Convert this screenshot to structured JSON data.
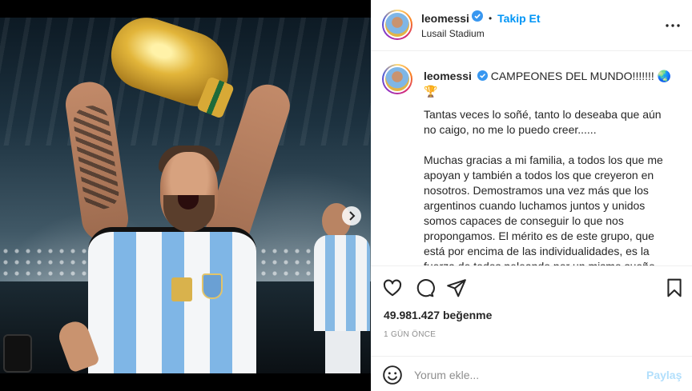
{
  "post": {
    "account": {
      "username": "leomessi",
      "separator": "•",
      "follow_label": "Takip Et",
      "location": "Lusail Stadium"
    },
    "caption": {
      "username": "leomessi",
      "headline": "CAMPEONES DEL MUNDO!!!!!!! ",
      "headline_emoji": "🌏 🏆",
      "paragraphs": [
        "Tantas veces lo soñé, tanto lo deseaba que aún no caigo, no me lo puedo creer......",
        "Muchas gracias a mi familia, a todos los que me apoyan y también a todos los que creyeron en nosotros. Demostramos una vez más que los argentinos cuando luchamos juntos y unidos somos capaces de conseguir lo que nos propongamos. El mérito es de este grupo, que está por encima de las individualidades, es la fuerza de todos peleando por un mismo sueño"
      ]
    },
    "likes": "49.981.427 beğenme",
    "timestamp": "1 GÜN ÖNCE",
    "comment": {
      "placeholder": "Yorum ekle...",
      "submit_label": "Paylaş"
    },
    "icons": {
      "verified": "verified-badge-icon",
      "more": "more-options-icon",
      "like": "heart-icon",
      "comment": "comment-icon",
      "share": "share-icon",
      "save": "bookmark-icon",
      "emoji": "emoji-icon",
      "carousel_next": "chevron-right-icon"
    },
    "colors": {
      "link": "#0095f6",
      "verified": "#3897f0",
      "muted": "#8e8e8e",
      "post_disabled": "#b2dffc"
    },
    "carousel": {
      "slides": 10,
      "active_index": 0
    }
  }
}
